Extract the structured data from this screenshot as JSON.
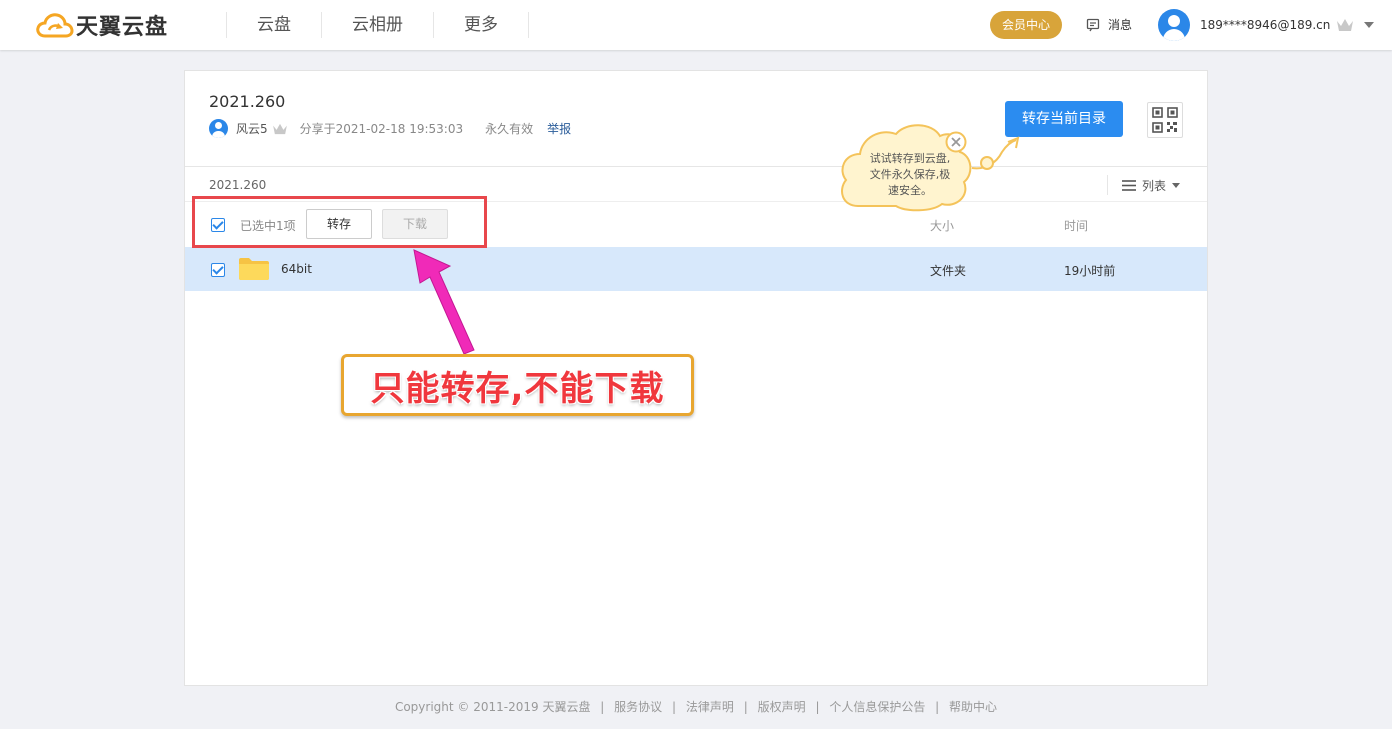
{
  "header": {
    "logo_text": "天翼云盘",
    "nav": [
      "云盘",
      "云相册",
      "更多"
    ],
    "vip_label": "会员中心",
    "message_label": "消息",
    "user_email": "189****8946@189.cn"
  },
  "share": {
    "title": "2021.260",
    "sharer": "风云5",
    "shared_at": "分享于2021-02-18 19:53:03",
    "validity": "永久有效",
    "report_label": "举报",
    "save_dir_label": "转存当前目录"
  },
  "list": {
    "breadcrumb": "2021.260",
    "view_label": "列表",
    "selected_text": "已选中1项",
    "save_label": "转存",
    "download_label": "下载",
    "col_size": "大小",
    "col_time": "时间",
    "rows": [
      {
        "name": "64bit",
        "type": "文件夹",
        "time": "19小时前"
      }
    ]
  },
  "tip": {
    "line1": "试试转存到云盘,",
    "line2": "文件永久保存,极",
    "line3": "速安全。"
  },
  "annotation": {
    "callout": "只能转存,不能下载"
  },
  "footer": {
    "copyright": "Copyright © 2011-2019 天翼云盘",
    "links": [
      "服务协议",
      "法律声明",
      "版权声明",
      "个人信息保护公告",
      "帮助中心"
    ]
  },
  "colors": {
    "accent_blue": "#2b8cf0",
    "vip_gold": "#d8a43a",
    "selected_row": "#d7e8fb",
    "annotation_red": "#e8474c",
    "annotation_pink": "#f02ab8",
    "callout_border": "#e8a630"
  }
}
